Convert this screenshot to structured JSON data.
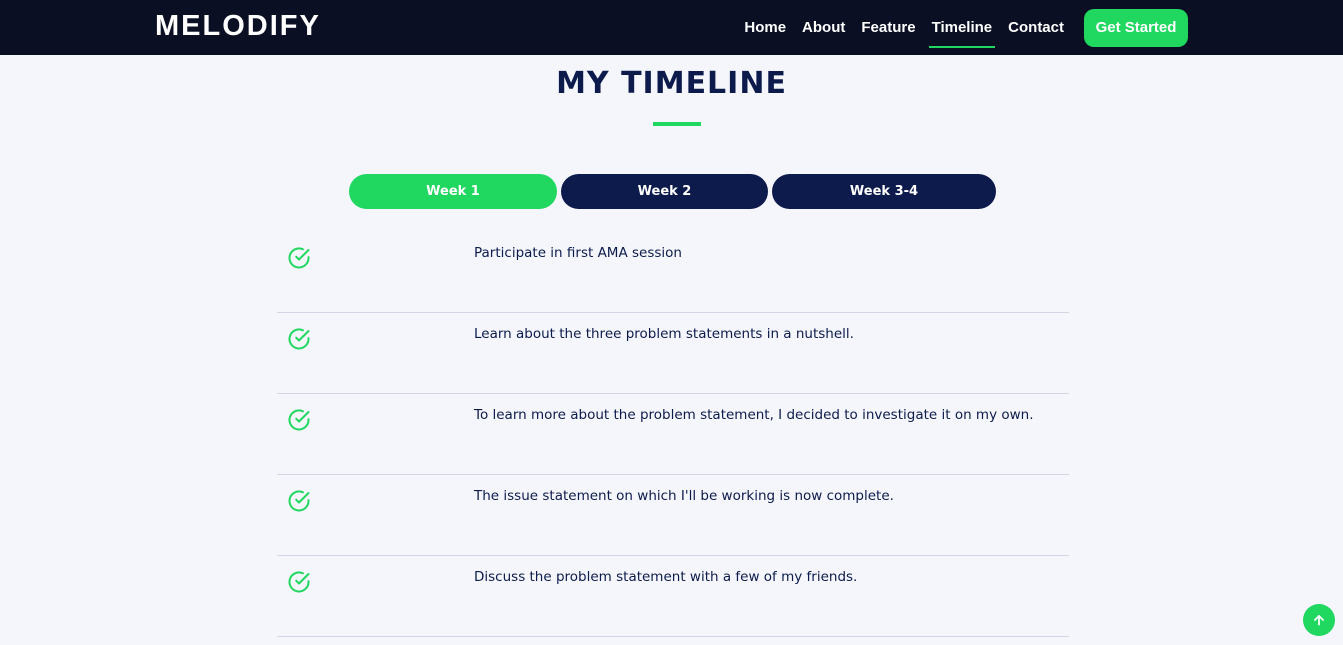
{
  "brand": {
    "name": "MELODIFY"
  },
  "nav": {
    "items": [
      {
        "label": "Home"
      },
      {
        "label": "About"
      },
      {
        "label": "Feature"
      },
      {
        "label": "Timeline",
        "active": true
      },
      {
        "label": "Contact"
      }
    ],
    "cta_label": "Get Started"
  },
  "page": {
    "title": "MY TIMELINE"
  },
  "tabs": [
    {
      "label": "Week 1",
      "active": true
    },
    {
      "label": "Week 2"
    },
    {
      "label": "Week 3-4"
    }
  ],
  "timeline": {
    "items": [
      {
        "text": "Participate in first AMA session",
        "icon": "check-circle-icon"
      },
      {
        "text": "Learn about the three problem statements in a nutshell.",
        "icon": "check-circle-icon"
      },
      {
        "text": "To learn more about the problem statement, I decided to investigate it on my own.",
        "icon": "check-circle-icon"
      },
      {
        "text": "The issue statement on which I'll be working is now complete.",
        "icon": "check-circle-icon"
      },
      {
        "text": "Discuss the problem statement with a few of my friends.",
        "icon": "check-circle-icon"
      }
    ]
  },
  "icons": {
    "scroll_top": "arrow-up-icon"
  },
  "colors": {
    "accent": "#20d760",
    "navy": "#0d1b4c",
    "navbar": "#0a0f24",
    "background": "#f4f6fb"
  }
}
